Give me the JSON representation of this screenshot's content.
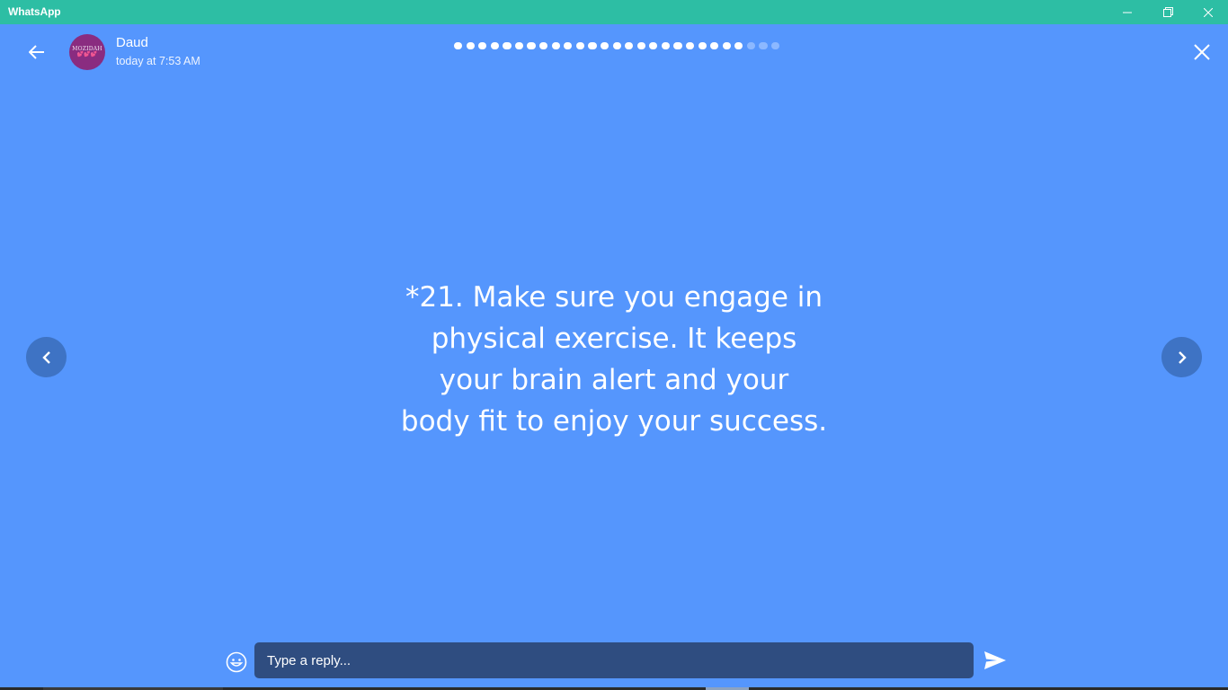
{
  "window": {
    "title": "WhatsApp",
    "controls": [
      "minimize-icon",
      "restore-icon",
      "close-icon"
    ]
  },
  "colors": {
    "titlebar": "#2dbea4",
    "story_background": "#5596fd",
    "nav_button": "#3e73c4",
    "reply_field": "#2f4d80"
  },
  "header": {
    "contact_name": "Daud",
    "timestamp": "today at 7:53 AM",
    "avatar_text": "MOZIDAH",
    "avatar_hearts": "💕💕💕"
  },
  "progress": {
    "total": 27,
    "viewed": 24
  },
  "story": {
    "text": "*21. Make sure you engage in\nphysical exercise. It keeps\nyour brain alert and your\nbody fit to enjoy your success."
  },
  "reply": {
    "placeholder": "Type a reply..."
  },
  "icons": {
    "back": "arrow-left-icon",
    "close": "close-icon",
    "prev": "chevron-left-icon",
    "next": "chevron-right-icon",
    "emoji": "smiley-icon",
    "send": "send-icon"
  }
}
